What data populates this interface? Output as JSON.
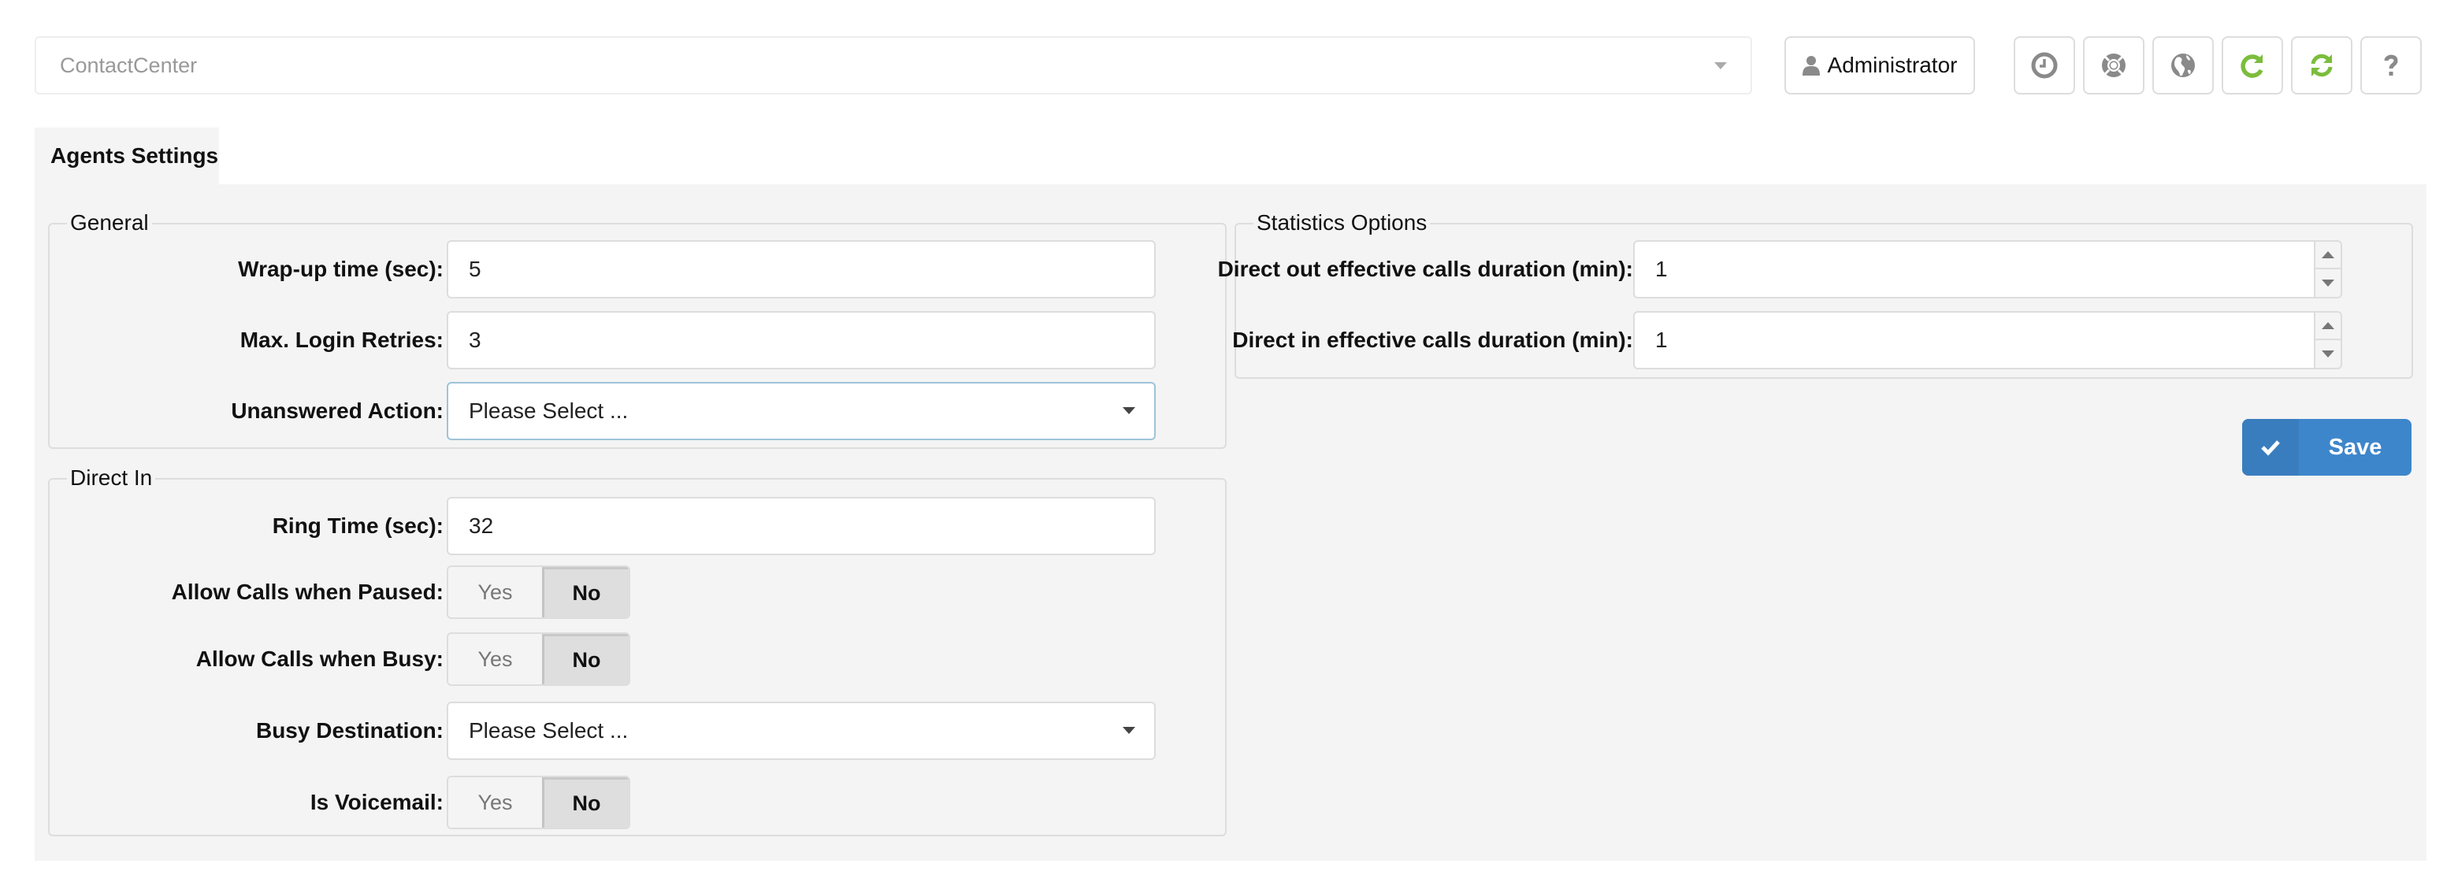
{
  "topbar": {
    "instance_select": {
      "value": "ContactCenter"
    },
    "user_button": {
      "label": "Administrator",
      "icon": "user-icon"
    },
    "icon_buttons": [
      {
        "name": "history",
        "icon": "clock-icon",
        "color": "#8a8a8a"
      },
      {
        "name": "support",
        "icon": "lifebuoy-icon",
        "color": "#8a8a8a"
      },
      {
        "name": "language",
        "icon": "globe-icon",
        "color": "#8a8a8a"
      },
      {
        "name": "reload",
        "icon": "redo-icon",
        "color": "#7cbd3c"
      },
      {
        "name": "refresh",
        "icon": "refresh-icon",
        "color": "#7cbd3c"
      },
      {
        "name": "help",
        "icon": "question-icon",
        "color": "#8a8a8a"
      }
    ]
  },
  "tabs": [
    {
      "label": "Agents Settings",
      "active": true
    }
  ],
  "general": {
    "legend": "General",
    "wrapup": {
      "label": "Wrap-up time (sec):",
      "value": "5"
    },
    "login_retries": {
      "label": "Max. Login Retries:",
      "value": "3"
    },
    "unanswered_action": {
      "label": "Unanswered Action:",
      "value": "Please Select ..."
    }
  },
  "direct_in": {
    "legend": "Direct In",
    "ring_time": {
      "label": "Ring Time (sec):",
      "value": "32"
    },
    "allow_paused": {
      "label": "Allow Calls when Paused:",
      "yes": "Yes",
      "no": "No",
      "selected": "No"
    },
    "allow_busy": {
      "label": "Allow Calls when Busy:",
      "yes": "Yes",
      "no": "No",
      "selected": "No"
    },
    "busy_destination": {
      "label": "Busy Destination:",
      "value": "Please Select ..."
    },
    "is_voicemail": {
      "label": "Is Voicemail:",
      "yes": "Yes",
      "no": "No",
      "selected": "No"
    }
  },
  "statistics": {
    "legend": "Statistics Options",
    "direct_out": {
      "label": "Direct out effective calls duration (min):",
      "value": "1"
    },
    "direct_in": {
      "label": "Direct in effective calls duration (min):",
      "value": "1"
    }
  },
  "actions": {
    "save_label": "Save",
    "accent": "#3e86cb"
  }
}
